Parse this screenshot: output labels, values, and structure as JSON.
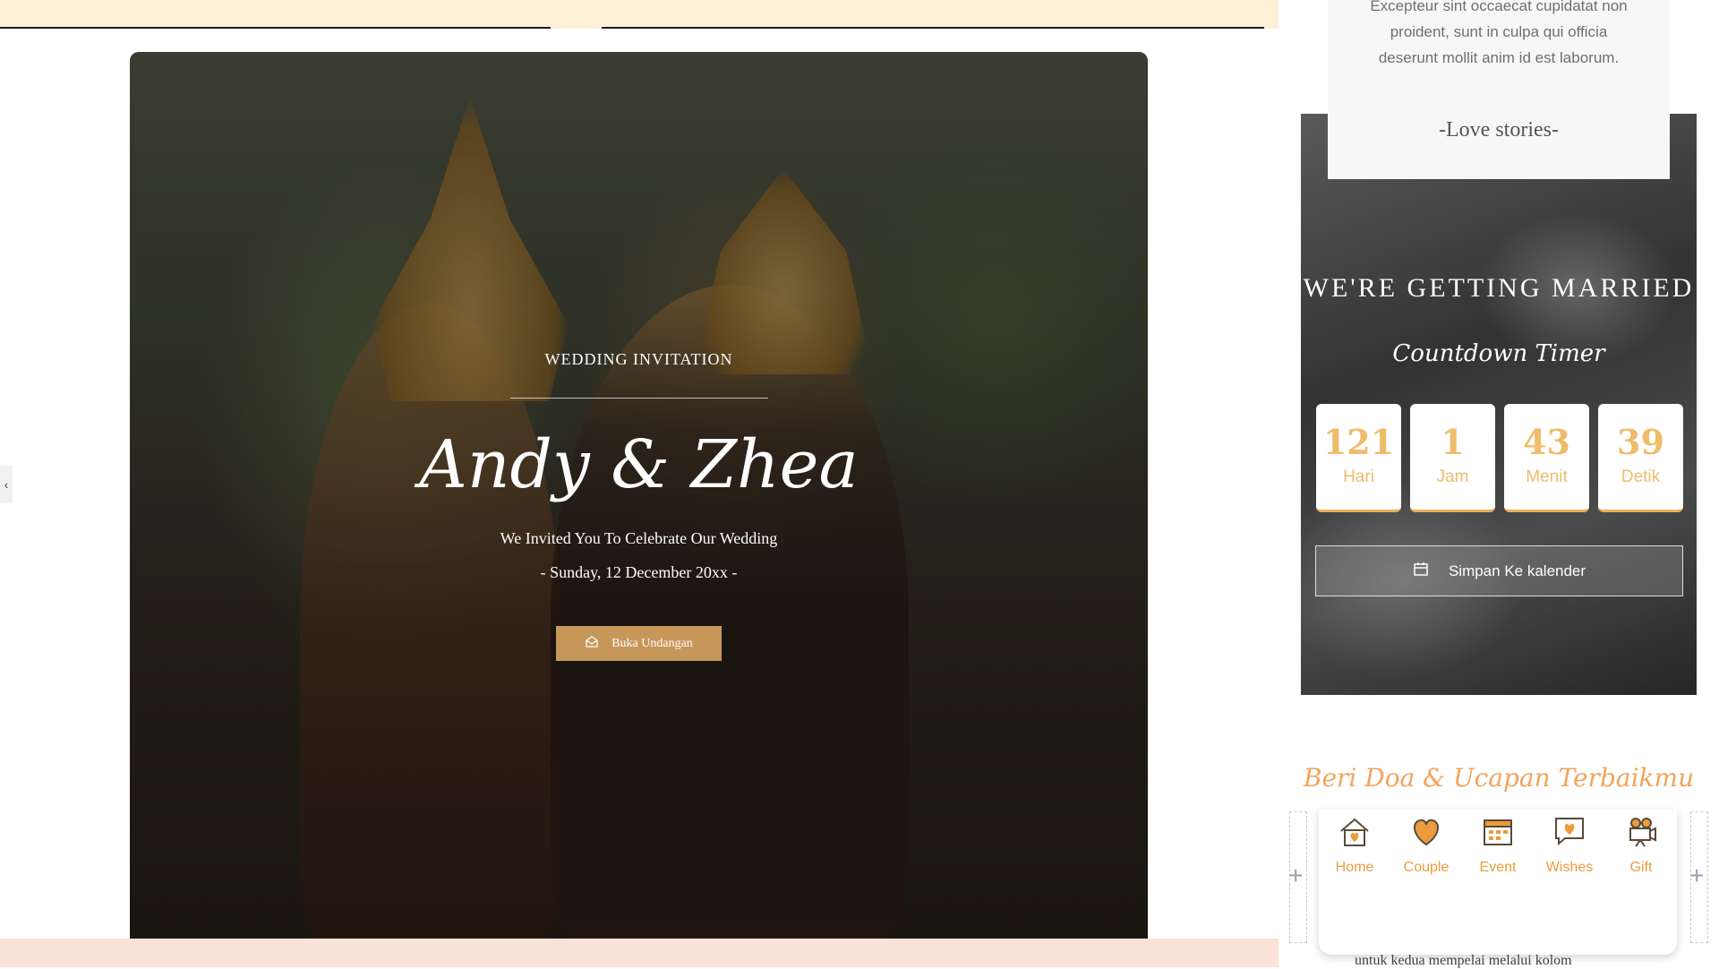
{
  "hero": {
    "eyebrow": "WEDDING INVITATION",
    "names": "Andy & Zhea",
    "invite_line": "We Invited You To Celebrate Our Wedding",
    "date_line": "- Sunday, 12 December 20xx -",
    "open_button": "Buka Undangan",
    "accent_color": "#c7975a"
  },
  "story": {
    "text": "Excepteur sint occaecat cupidatat non proident, sunt in culpa qui officia deserunt mollit anim id est laborum.",
    "title": "-Love stories-"
  },
  "countdown": {
    "heading": "WE'RE GETTING MARRIED",
    "subheading": "Countdown Timer",
    "units": [
      {
        "value": "121",
        "label": "Hari"
      },
      {
        "value": "1",
        "label": "Jam"
      },
      {
        "value": "43",
        "label": "Menit"
      },
      {
        "value": "39",
        "label": "Detik"
      }
    ],
    "save_button": "Simpan Ke kalender",
    "accent_color": "#eebc6a"
  },
  "wishes": {
    "title": "Beri Doa & Ucapan Terbaikmu",
    "peek_text": "untuk kedua mempelai melalui kolom"
  },
  "nav": {
    "items": [
      {
        "label": "Home",
        "icon": "home-heart-icon"
      },
      {
        "label": "Couple",
        "icon": "hearts-icon"
      },
      {
        "label": "Event",
        "icon": "calendar-icon"
      },
      {
        "label": "Wishes",
        "icon": "message-heart-icon"
      },
      {
        "label": "Gift",
        "icon": "camera-icon"
      }
    ],
    "accent_color": "#eb9c3e"
  },
  "side_tab": "‹",
  "plus": "+"
}
